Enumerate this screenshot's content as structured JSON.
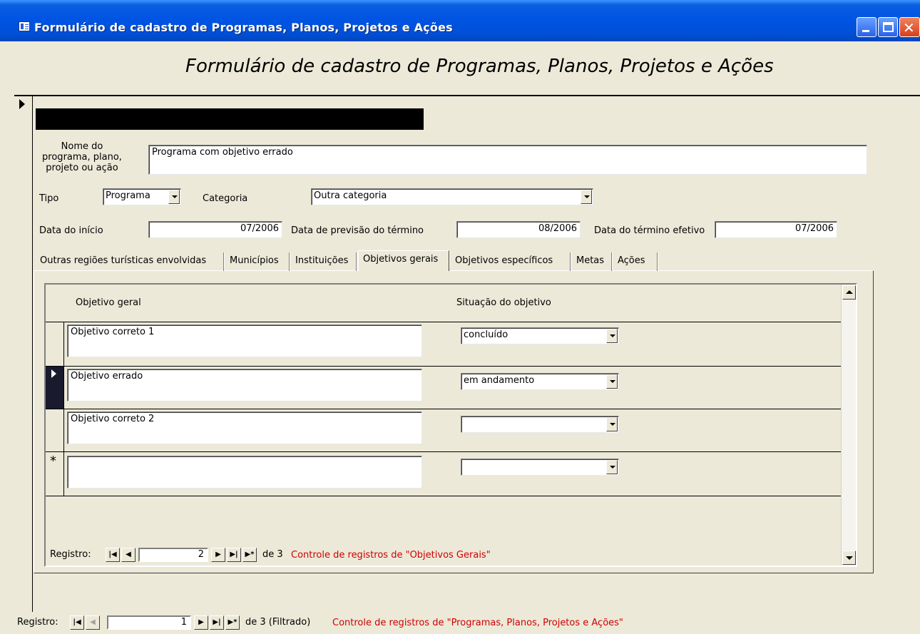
{
  "window": {
    "title": "Formulário de cadastro de Programas, Planos, Projetos e Ações"
  },
  "form": {
    "heading": "Formulário de cadastro de Programas, Planos, Projetos e Ações",
    "nome_label": "Nome do programa, plano, projeto ou ação",
    "nome_value": "Programa com objetivo errado",
    "tipo_label": "Tipo",
    "tipo_value": "Programa",
    "categoria_label": "Categoria",
    "categoria_value": "Outra categoria",
    "data_inicio_label": "Data do início",
    "data_inicio_value": "07/2006",
    "data_previsao_label": "Data de previsão do término",
    "data_previsao_value": "08/2006",
    "data_termino_label": "Data do término efetivo",
    "data_termino_value": "07/2006"
  },
  "tabs": [
    {
      "label": "Outras regiões turísticas envolvidas"
    },
    {
      "label": "Municípios"
    },
    {
      "label": "Instituições"
    },
    {
      "label": "Objetivos gerais"
    },
    {
      "label": "Objetivos específicos"
    },
    {
      "label": "Metas"
    },
    {
      "label": "Ações"
    }
  ],
  "active_tab": "Objetivos gerais",
  "subform": {
    "col_objetivo": "Objetivo geral",
    "col_situacao": "Situação do objetivo",
    "rows": [
      {
        "objetivo": "Objetivo correto 1",
        "situacao": "concluído"
      },
      {
        "objetivo": "Objetivo errado",
        "situacao": "em andamento"
      },
      {
        "objetivo": "Objetivo correto 2",
        "situacao": ""
      },
      {
        "objetivo": "",
        "situacao": ""
      }
    ],
    "new_record_marker": "*",
    "nav": {
      "label": "Registro:",
      "current": "2",
      "of_text": "de 3",
      "description": "Controle de registros de \"Objetivos Gerais\""
    }
  },
  "main_nav": {
    "label": "Registro:",
    "current": "1",
    "of_text": "de 3 (Filtrado)",
    "description": "Controle de registros de \"Programas, Planos, Projetos e Ações\""
  },
  "icons": {
    "first": "first-record-icon",
    "prev": "previous-record-icon",
    "next": "next-record-icon",
    "last": "last-record-icon",
    "new": "new-record-icon"
  }
}
